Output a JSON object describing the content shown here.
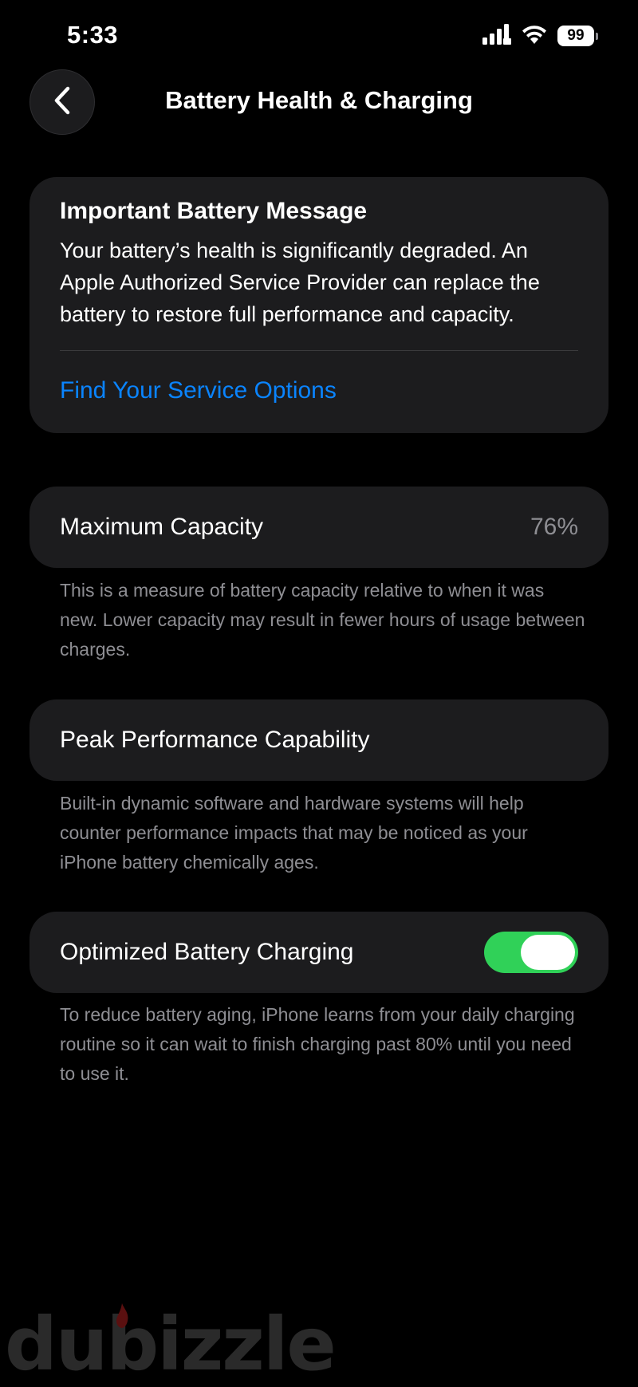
{
  "status_bar": {
    "time": "5:33",
    "battery_level": "99",
    "icons": [
      "cellular-signal-icon",
      "wifi-icon",
      "battery-icon"
    ]
  },
  "nav": {
    "back_icon": "chevron-left-icon",
    "title": "Battery Health & Charging"
  },
  "message_card": {
    "title": "Important Battery Message",
    "body": "Your battery’s health is significantly degraded. An Apple Authorized Service Provider can replace the battery to restore full performance and capacity.",
    "link": "Find Your Service Options"
  },
  "maximum_capacity": {
    "label": "Maximum Capacity",
    "value": "76%",
    "footnote": "This is a measure of battery capacity relative to when it was new. Lower capacity may result in fewer hours of usage between charges."
  },
  "peak_performance": {
    "label": "Peak Performance Capability",
    "footnote": "Built-in dynamic software and hardware systems will help counter performance impacts that may be noticed as your iPhone battery chemically ages."
  },
  "optimized_charging": {
    "label": "Optimized Battery Charging",
    "enabled": true,
    "footnote": "To reduce battery aging, iPhone learns from your daily charging routine so it can wait to finish charging past 80% until you need to use it."
  },
  "watermark": {
    "text": "dubizzle"
  },
  "colors": {
    "background": "#000000",
    "card": "#1c1c1e",
    "link": "#0a84ff",
    "secondary_text": "#8e8e93",
    "toggle_on": "#30d158"
  }
}
